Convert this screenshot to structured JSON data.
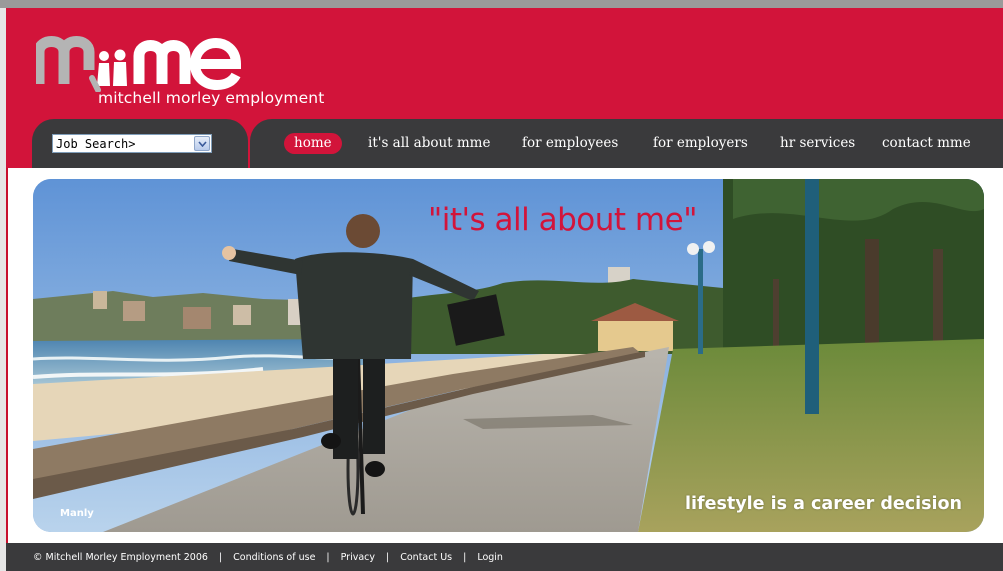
{
  "brand": {
    "logo_text": "mme",
    "tagline": "mitchell morley employment",
    "colors": {
      "primary": "#d2143a",
      "dark": "#3a3a3c",
      "logo_grey": "#b4b4b4"
    }
  },
  "search": {
    "label": "Job Search>",
    "arrow_icon": "chevron-down-icon"
  },
  "nav": {
    "items": [
      {
        "label": "home",
        "active": true
      },
      {
        "label": "it's all about mme",
        "active": false
      },
      {
        "label": "for employees",
        "active": false
      },
      {
        "label": "for employers",
        "active": false
      },
      {
        "label": "hr services",
        "active": false
      },
      {
        "label": "contact mme",
        "active": false
      }
    ]
  },
  "hero": {
    "quote": "\"it's all about me\"",
    "caption": "lifestyle is a career decision",
    "location": "Manly"
  },
  "footer": {
    "copyright": "© Mitchell Morley Employment 2006",
    "separator": "|",
    "links": [
      "Conditions of use",
      "Privacy",
      "Contact Us",
      "Login"
    ]
  }
}
